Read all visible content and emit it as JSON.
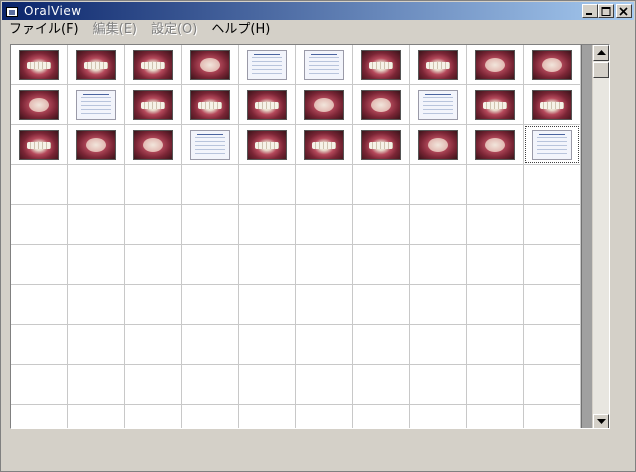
{
  "window": {
    "title": "OralView"
  },
  "menu": [
    {
      "label": "ファイル(F)",
      "enabled": true
    },
    {
      "label": "編集(E)",
      "enabled": false
    },
    {
      "label": "設定(O)",
      "enabled": false
    },
    {
      "label": "ヘルプ(H)",
      "enabled": true
    }
  ],
  "grid": {
    "columns": 10,
    "visible_rows": 10,
    "selected_index": 29,
    "thumbnails": [
      "mouth",
      "mouth",
      "mouth",
      "open",
      "chart",
      "chart",
      "mouth",
      "mouth",
      "open",
      "open",
      "open",
      "chart",
      "mouth",
      "mouth",
      "mouth",
      "open",
      "open",
      "chart",
      "mouth",
      "mouth",
      "mouth",
      "open",
      "open",
      "chart",
      "mouth",
      "mouth",
      "mouth",
      "open",
      "open",
      "chart"
    ]
  },
  "icons": {
    "app": "app-window-icon",
    "minimize": "minimize-icon",
    "maximize": "maximize-icon",
    "close": "close-icon",
    "scroll_up": "arrow-up-icon",
    "scroll_down": "arrow-down-icon"
  }
}
